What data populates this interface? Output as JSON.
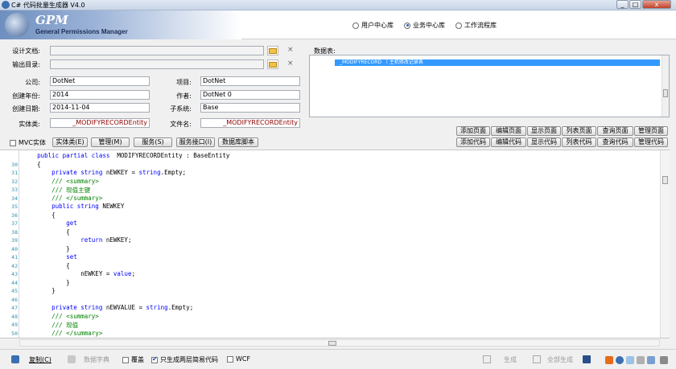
{
  "window": {
    "title": "C# 代码批量生成器 V4.0",
    "min": "_",
    "max": "□",
    "close": "x"
  },
  "header": {
    "logo_title": "GPM",
    "logo_subtitle": "General Permissions Manager",
    "radios": [
      {
        "label": "用户中心库",
        "selected": false
      },
      {
        "label": "业务中心库",
        "selected": true
      },
      {
        "label": "工作流程库",
        "selected": false
      }
    ]
  },
  "form": {
    "design_doc_label": "设计文档:",
    "design_doc_value": "",
    "output_dir_label": "输出目录:",
    "output_dir_value": "",
    "company_label": "公司:",
    "company_value": "DotNet",
    "project_label": "项目:",
    "project_value": "DotNet",
    "year_label": "创建年份:",
    "year_value": "2014",
    "author_label": "作者:",
    "author_value": "DotNet 0",
    "date_label": "创建日期:",
    "date_value": "2014-11-04",
    "subsystem_label": "子系统:",
    "subsystem_value": "Base",
    "entity_label": "实体类:",
    "entity_value": "_MODIFYRECORDEntity",
    "filename_label": "文件名:",
    "filename_value": "_MODIFYRECORDEntity",
    "dbtable_label": "数据表:",
    "dbtable_row": "_MODIFYRECORD （ 主机修改记录表",
    "clear_icon": "×"
  },
  "buttons_row1": [
    "添加页面",
    "编辑页面",
    "显示页面",
    "列表页面",
    "查询页面",
    "管理页面"
  ],
  "buttons_row2": [
    "添加代码",
    "编辑代码",
    "显示代码",
    "列表代码",
    "查询代码",
    "管理代码"
  ],
  "toolbar": {
    "mvc_label": "MVC实体",
    "mvc_checked": false,
    "tabs": [
      "实体类(E)",
      "管理(M)",
      "服务(S)",
      "服务接口(I)",
      "数据库脚本"
    ]
  },
  "code": {
    "lines": [
      {
        "n": "",
        "html": "    <span class=\"kw\">public</span> <span class=\"kw\">partial</span> <span class=\"kw\">class</span>  MODIFYRECORDEntity : BaseEntity"
      },
      {
        "n": "30",
        "html": "    {"
      },
      {
        "n": "31",
        "html": "        <span class=\"kw\">private</span> <span class=\"kw\">string</span> nEWKEY = <span class=\"kw\">string</span>.Empty;"
      },
      {
        "n": "32",
        "html": "        <span class=\"cm\">/// &lt;summary&gt;</span>"
      },
      {
        "n": "33",
        "html": "        <span class=\"cm\">/// 现值主键</span>"
      },
      {
        "n": "34",
        "html": "        <span class=\"cm\">/// &lt;/summary&gt;</span>"
      },
      {
        "n": "35",
        "html": "        <span class=\"kw\">public</span> <span class=\"kw\">string</span> NEWKEY"
      },
      {
        "n": "36",
        "html": "        {"
      },
      {
        "n": "37",
        "html": "            <span class=\"kw\">get</span>"
      },
      {
        "n": "38",
        "html": "            {"
      },
      {
        "n": "39",
        "html": "                <span class=\"kw\">return</span> nEWKEY;"
      },
      {
        "n": "40",
        "html": "            }"
      },
      {
        "n": "41",
        "html": "            <span class=\"kw\">set</span>"
      },
      {
        "n": "42",
        "html": "            {"
      },
      {
        "n": "43",
        "html": "                nEWKEY = <span class=\"kw\">value</span>;"
      },
      {
        "n": "44",
        "html": "            }"
      },
      {
        "n": "45",
        "html": "        }"
      },
      {
        "n": "46",
        "html": ""
      },
      {
        "n": "47",
        "html": "        <span class=\"kw\">private</span> <span class=\"kw\">string</span> nEWVALUE = <span class=\"kw\">string</span>.Empty;"
      },
      {
        "n": "48",
        "html": "        <span class=\"cm\">/// &lt;summary&gt;</span>"
      },
      {
        "n": "49",
        "html": "        <span class=\"cm\">/// 现值</span>"
      },
      {
        "n": "50",
        "html": "        <span class=\"cm\">/// &lt;/summary&gt;</span>"
      }
    ]
  },
  "bottom": {
    "copy": "复制(C)",
    "dict": "数据字典",
    "overwrite": "覆盖",
    "overwrite_checked": false,
    "simple": "只生成两层简易代码",
    "simple_checked": true,
    "wcf": "WCF",
    "wcf_checked": false,
    "generate": "生成",
    "generate_all": "全部生成"
  },
  "colors": {
    "accent": "#3399ff",
    "keyword": "#0000ff",
    "comment": "#008000",
    "line_number": "#2b91af"
  }
}
